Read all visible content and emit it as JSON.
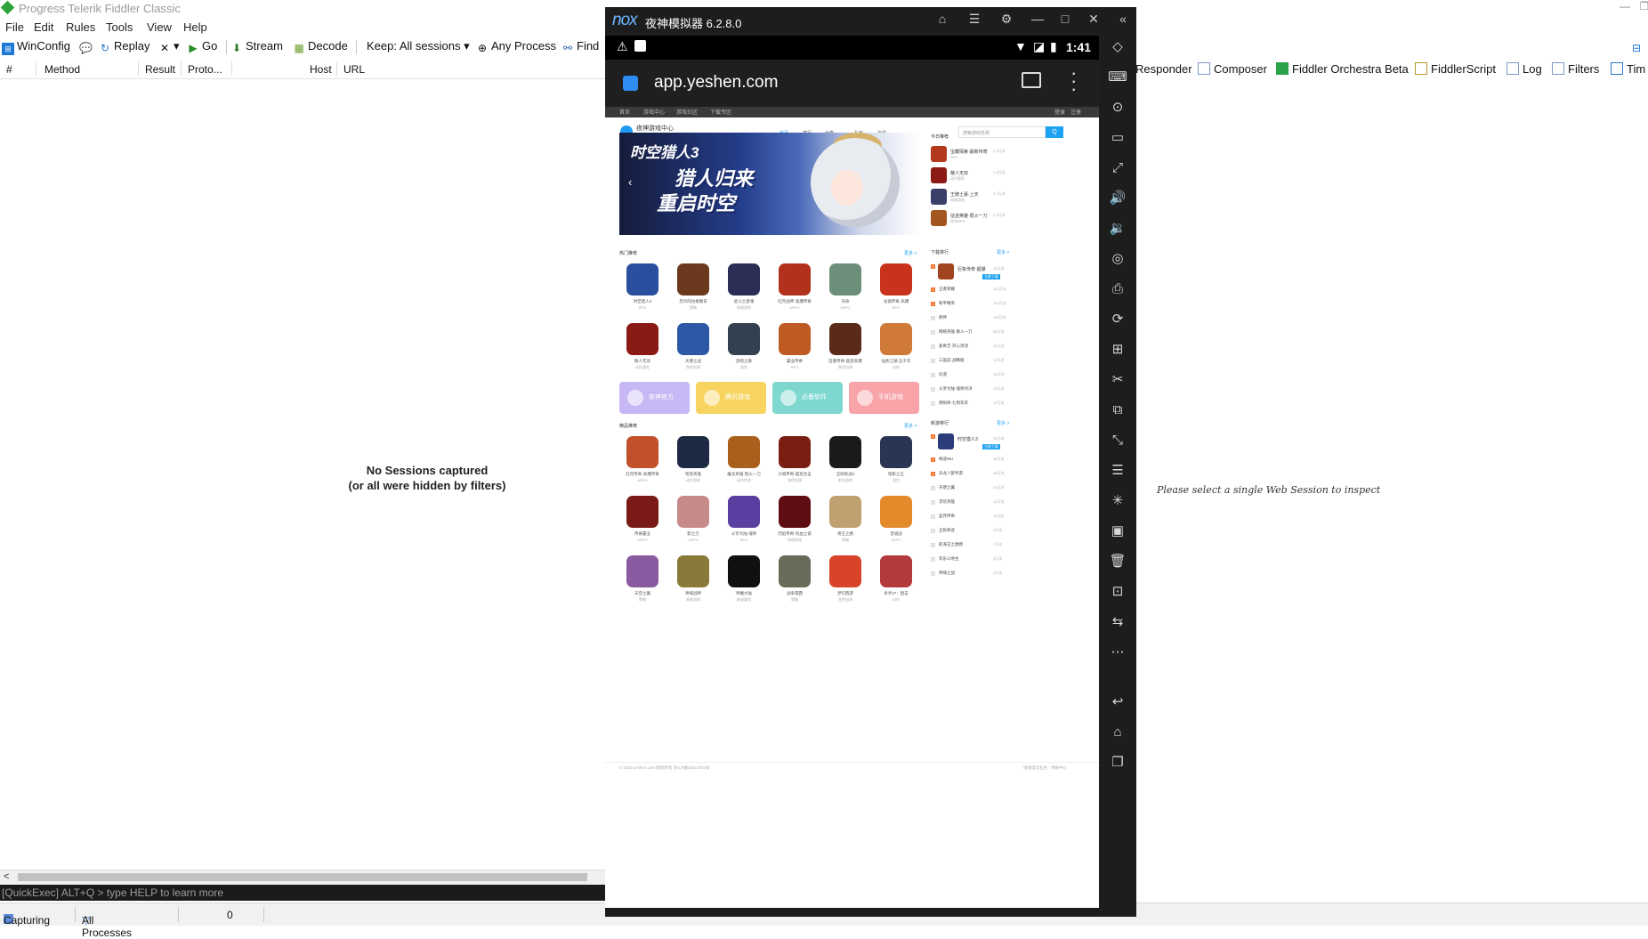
{
  "fiddler": {
    "title": "Progress Telerik Fiddler Classic",
    "menu": [
      "File",
      "Edit",
      "Rules",
      "Tools",
      "View",
      "Help"
    ],
    "toolbar": {
      "winconfig": "WinConfig",
      "replay": "Replay",
      "go": "Go",
      "stream": "Stream",
      "decode": "Decode",
      "keep": "Keep: All sessions",
      "any_process": "Any Process",
      "find": "Find"
    },
    "columns": [
      "#",
      "Method",
      "Result",
      "Proto...",
      "Host",
      "URL"
    ],
    "empty_line1": "No Sessions captured",
    "empty_line2": "(or all were hidden by filters)",
    "quickexec": "[QuickExec] ALT+Q > type HELP to learn more",
    "status": {
      "capturing": "Capturing",
      "processes": "All Processes",
      "count": "0"
    },
    "inspector_tabs": [
      "Responder",
      "Composer",
      "Fiddler Orchestra Beta",
      "FiddlerScript",
      "Log",
      "Filters",
      "Tim"
    ],
    "inspector_tab_icons": [
      "",
      "composer-icon",
      "fo-icon",
      "script-icon",
      "log-icon",
      "filters-icon",
      "timeline-icon"
    ],
    "inspector_message": "Please select a single Web Session to inspect"
  },
  "nox": {
    "brand": "nox",
    "title": "夜神模拟器 6.2.8.0",
    "clock": "1:41",
    "url": "app.yeshen.com",
    "top_strip": [
      "首页",
      "游戏中心",
      "游戏社区",
      "下载专区",
      "登录",
      "注册"
    ],
    "site": {
      "name": "夜神游戏中心",
      "sub": "yeshen.com",
      "nav": [
        "首页",
        "排行",
        "分类",
        "礼包",
        "资讯"
      ],
      "search_placeholder": "搜索游戏名称",
      "search_btn": "Q"
    },
    "banner": {
      "title_top": "时空猎人3",
      "title_mid": "猎人归来",
      "title_bot": "重启时空"
    },
    "today_title": "今日推荐",
    "today": [
      {
        "name": "宝藏探索·最新传奇",
        "sub": "RPG",
        "count": "2.3万次"
      },
      {
        "name": "散人无双",
        "sub": "动作冒险",
        "count": "1.8万次"
      },
      {
        "name": "王牌土豪·上天",
        "sub": "网络游戏",
        "count": "3.1万次"
      },
      {
        "name": "征途英雄·怒火一刀",
        "sub": "传奇RPG",
        "count": "2.0万次"
      }
    ],
    "hot_title": "热门推荐",
    "more": "更多 >",
    "hot_apps": [
      {
        "name": "时空猎人3",
        "cat": "RPG"
      },
      {
        "name": "无尽的拉格朗日",
        "cat": "策略"
      },
      {
        "name": "星斗士星魂",
        "cat": "网络游戏"
      },
      {
        "name": "红月战神·高爆传奇",
        "cat": "ARPG"
      },
      {
        "name": "天命",
        "cat": "ARPG"
      },
      {
        "name": "龙城传奇·高爆",
        "cat": "RPG"
      },
      {
        "name": "散人无双",
        "cat": "动作冒险"
      },
      {
        "name": "天使之战",
        "cat": "角色扮演"
      },
      {
        "name": "黑暗之歌",
        "cat": "冒险"
      },
      {
        "name": "霸业传奇",
        "cat": "RPG"
      },
      {
        "name": "狂暴传奇·超变高爆",
        "cat": "角色扮演"
      },
      {
        "name": "仙侠江湖·五千年",
        "cat": "仙侠"
      }
    ],
    "promos": [
      "夜神官方",
      "腾讯游戏",
      "必备软件",
      "手机游戏"
    ],
    "download_title": "下载排行",
    "download_top": {
      "name": "巨象传奇·超爆",
      "count": "30万次",
      "btn": "立即下载"
    },
    "download_list": [
      "王者荣耀",
      "和平精英",
      "原神",
      "网络英雄·散人一刀",
      "爱奇艺·开心消消",
      "三国志·战略版",
      "问道",
      "斗罗大陆·魂师对决",
      "阴阳师·七周年庆"
    ],
    "download_counts": [
      "147万次",
      "123万次",
      "110万次",
      "55万次",
      "34万次",
      "19万次",
      "16万次",
      "13万次",
      "12万次",
      "25万次"
    ],
    "featured_title": "精品推荐",
    "featured_apps": [
      {
        "name": "红月传奇·高爆传奇",
        "cat": "ARPG"
      },
      {
        "name": "暗黑英雄",
        "cat": "动作游戏"
      },
      {
        "name": "屠龙英雄·怒火一刀",
        "cat": "动作传奇"
      },
      {
        "name": "沙城传奇·超变合击",
        "cat": "角色扮演"
      },
      {
        "name": "全民枪战2",
        "cat": "射击游戏"
      },
      {
        "name": "暗影之王",
        "cat": "冒险"
      },
      {
        "name": "传奇霸业",
        "cat": "ARPG"
      },
      {
        "name": "影之刃",
        "cat": "ARPG"
      },
      {
        "name": "斗罗大陆·魂师",
        "cat": "RPG"
      },
      {
        "name": "烈焰传奇·热血之城",
        "cat": "网络游戏"
      },
      {
        "name": "将王之路",
        "cat": "策略"
      },
      {
        "name": "皇城战",
        "cat": "ARPG"
      },
      {
        "name": "天空之翼",
        "cat": "策略"
      },
      {
        "name": "神域战神",
        "cat": "网络游戏"
      },
      {
        "name": "神魔大陆",
        "cat": "解谜冒险"
      },
      {
        "name": "战争雷霆",
        "cat": "策略"
      },
      {
        "name": "梦幻西游",
        "cat": "角色扮演"
      },
      {
        "name": "杀手47：狙击",
        "cat": "动作"
      }
    ],
    "new_title": "新游排行",
    "new_top": {
      "name": "时空猎人3",
      "count": "30万次",
      "btn": "立即下载"
    },
    "new_list": [
      "奇迹MU",
      "天龙八部手游",
      "天使之翼",
      "贪玩英雄",
      "蓝月传奇",
      "全民奇迹",
      "航海王之激燃",
      "欢乐斗地主",
      "神域之战"
    ],
    "new_counts": [
      "38万次",
      "16万次",
      "14万次",
      "12万次",
      "11万次",
      "9万次",
      "7万次",
      "5万次",
      "4万次",
      "3万次"
    ],
    "footer_left": "© 2019 yeshen.com 版权所有 京ICP备15013704号",
    "footer_right": "增值电信业务 · 举报中心"
  },
  "colors": {
    "accent": "#1da1f2",
    "hot": "#f5722e",
    "nox_bg": "#1d1d1d"
  }
}
